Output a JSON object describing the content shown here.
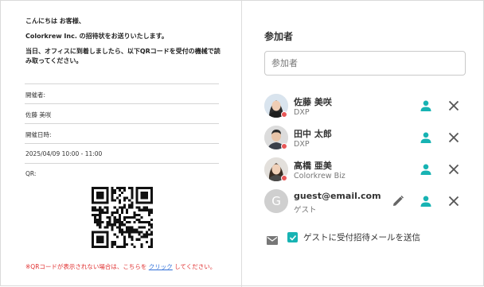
{
  "email": {
    "greeting": "こんにちは お客様、",
    "intro": "Colorkrew Inc. の招待状をお送りいたします。",
    "instruction": "当日、オフィスに到着しましたら、以下QRコードを受付の機械で読み取ってください。",
    "host_label": "開催者:",
    "host_value": "佐藤 美咲",
    "datetime_label": "開催日時:",
    "datetime_value": "2025/04/09 10:00 - 11:00",
    "qr_label": "QR:",
    "notice_prefix": "※QRコードが表示されない場合は、こちらを ",
    "notice_link": "クリック",
    "notice_suffix": " してください。",
    "notice_color": "#e03030",
    "link_color": "#2f6fd8"
  },
  "panel": {
    "title": "参加者",
    "search_placeholder": "参加者",
    "participants": [
      {
        "name": "佐藤 美咲",
        "org": "DXP",
        "avatar": "photo-woman",
        "status_color": "#e85757"
      },
      {
        "name": "田中 太郎",
        "org": "DXP",
        "avatar": "photo-man",
        "status_color": "#e85757"
      },
      {
        "name": "高橋 亜美",
        "org": "Colorkrew Biz",
        "avatar": "photo-woman",
        "status_color": "#e85757"
      },
      {
        "name": "guest@email.com",
        "org": "ゲスト",
        "avatar": "G",
        "status_color": ""
      }
    ],
    "send_invite_label": "ゲストに受付招待メールを送信",
    "accent_color": "#17b3b3"
  }
}
